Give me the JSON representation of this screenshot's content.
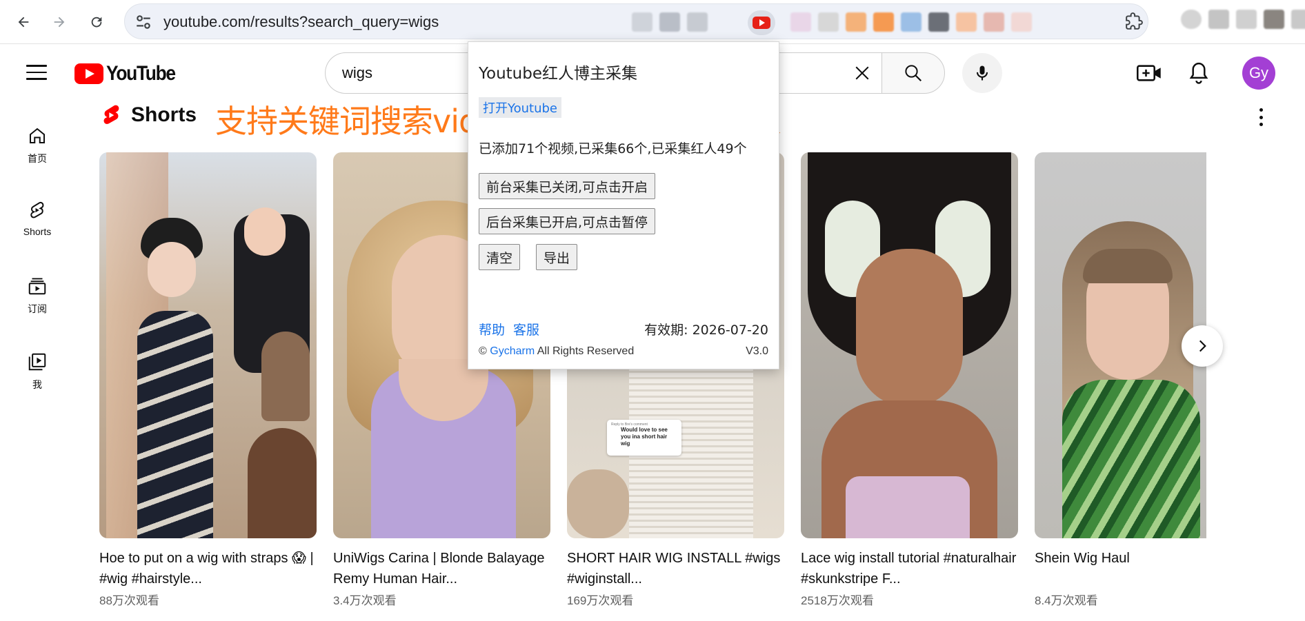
{
  "browser": {
    "url": "youtube.com/results?search_query=wigs",
    "icons": [
      "back-icon",
      "forward-icon",
      "reload-icon",
      "site-settings-icon",
      "extension-youtube-icon",
      "extensions-puzzle-icon"
    ]
  },
  "youtube": {
    "logo_text": "YouTube",
    "search_value": "wigs",
    "avatar_initials": "Gy",
    "guide": [
      {
        "label": "首页",
        "icon": "home-icon"
      },
      {
        "label": "Shorts",
        "icon": "shorts-icon"
      },
      {
        "label": "订阅",
        "icon": "subscriptions-icon"
      },
      {
        "label": "我",
        "icon": "you-icon"
      }
    ],
    "shelf_title": "Shorts",
    "promo_text": "支持关键词搜索videos、shorts采集红人",
    "shorts": [
      {
        "title": "Hoe to put on a wig with straps 😱 | #wig #hairstyle...",
        "views": "88万次观看"
      },
      {
        "title": "UniWigs Carina | Blonde Balayage Remy Human Hair...",
        "views": "3.4万次观看"
      },
      {
        "title": "SHORT HAIR WIG INSTALL #wigs #wiginstall...",
        "views": "169万次观看"
      },
      {
        "title": "Lace wig install tutorial #naturalhair #skunkstripe F...",
        "views": "2518万次观看"
      },
      {
        "title": "Shein Wig Haul",
        "views": "8.4万次观看"
      }
    ],
    "overlay_comment": {
      "reply_to": "Reply to Bre's comment",
      "text": "Would love to see you ina short hair wig"
    }
  },
  "popup": {
    "title": "Youtube红人博主采集",
    "open_link": "打开Youtube",
    "stats": "已添加71个视频,已采集66个,已采集红人49个",
    "btn_foreground": "前台采集已关闭,可点击开启",
    "btn_background": "后台采集已开启,可点击暂停",
    "btn_clear": "清空",
    "btn_export": "导出",
    "help": "帮助",
    "service": "客服",
    "validity": "有效期: 2026-07-20",
    "copyright_prefix": "©",
    "brand": "Gycharm",
    "copyright_suffix": "All Rights Reserved",
    "version": "V3.0"
  }
}
